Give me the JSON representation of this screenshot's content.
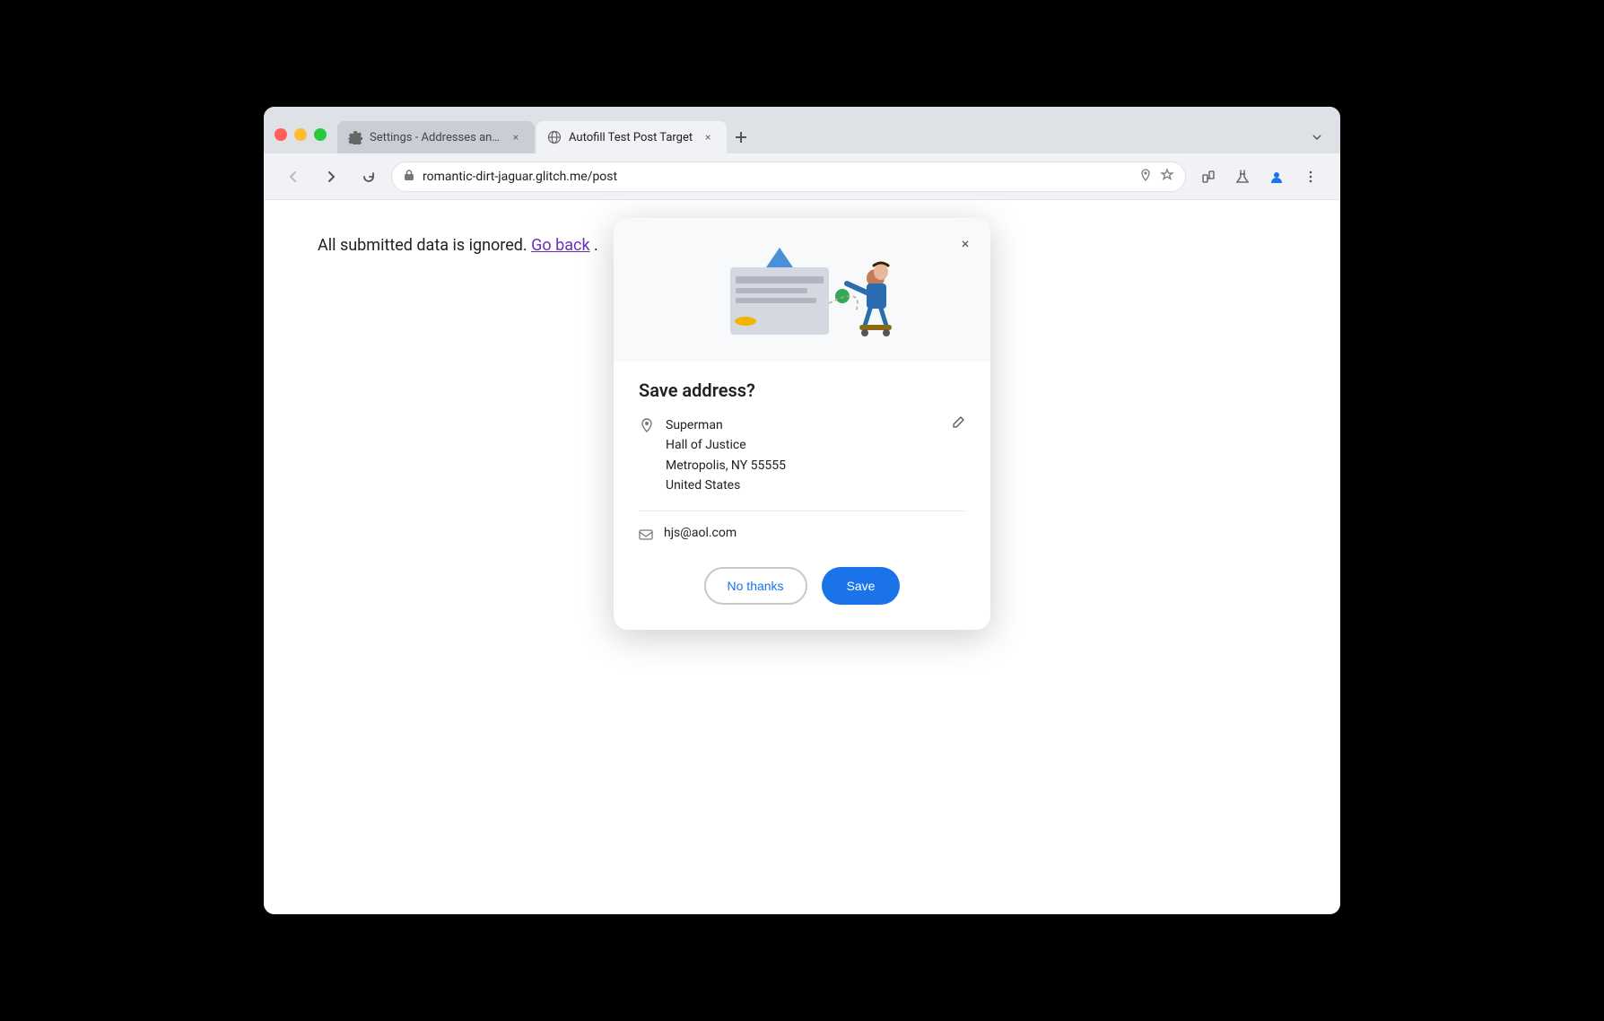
{
  "browser": {
    "tabs": [
      {
        "id": "settings-tab",
        "label": "Settings - Addresses and mo",
        "icon": "gear",
        "active": false
      },
      {
        "id": "autofill-tab",
        "label": "Autofill Test Post Target",
        "icon": "globe",
        "active": true
      }
    ],
    "new_tab_label": "+",
    "dropdown_label": "▾",
    "address_bar": {
      "url": "romantic-dirt-jaguar.glitch.me/post",
      "icon": "🔒"
    },
    "nav": {
      "back": "←",
      "forward": "→",
      "refresh": "↻"
    }
  },
  "page": {
    "content_text": "All submitted data is ignored.",
    "go_back_link": "Go back"
  },
  "dialog": {
    "title": "Save address?",
    "close_label": "×",
    "address": {
      "name": "Superman",
      "line1": "Hall of Justice",
      "line2": "Metropolis, NY 55555",
      "country": "United States"
    },
    "email": "hjs@aol.com",
    "buttons": {
      "no_thanks": "No thanks",
      "save": "Save"
    }
  },
  "colors": {
    "accent_blue": "#1a73e8",
    "link_purple": "#6b2fba",
    "tab_active_bg": "#f0f2f5",
    "tab_inactive_bg": "#c8cdd6"
  }
}
